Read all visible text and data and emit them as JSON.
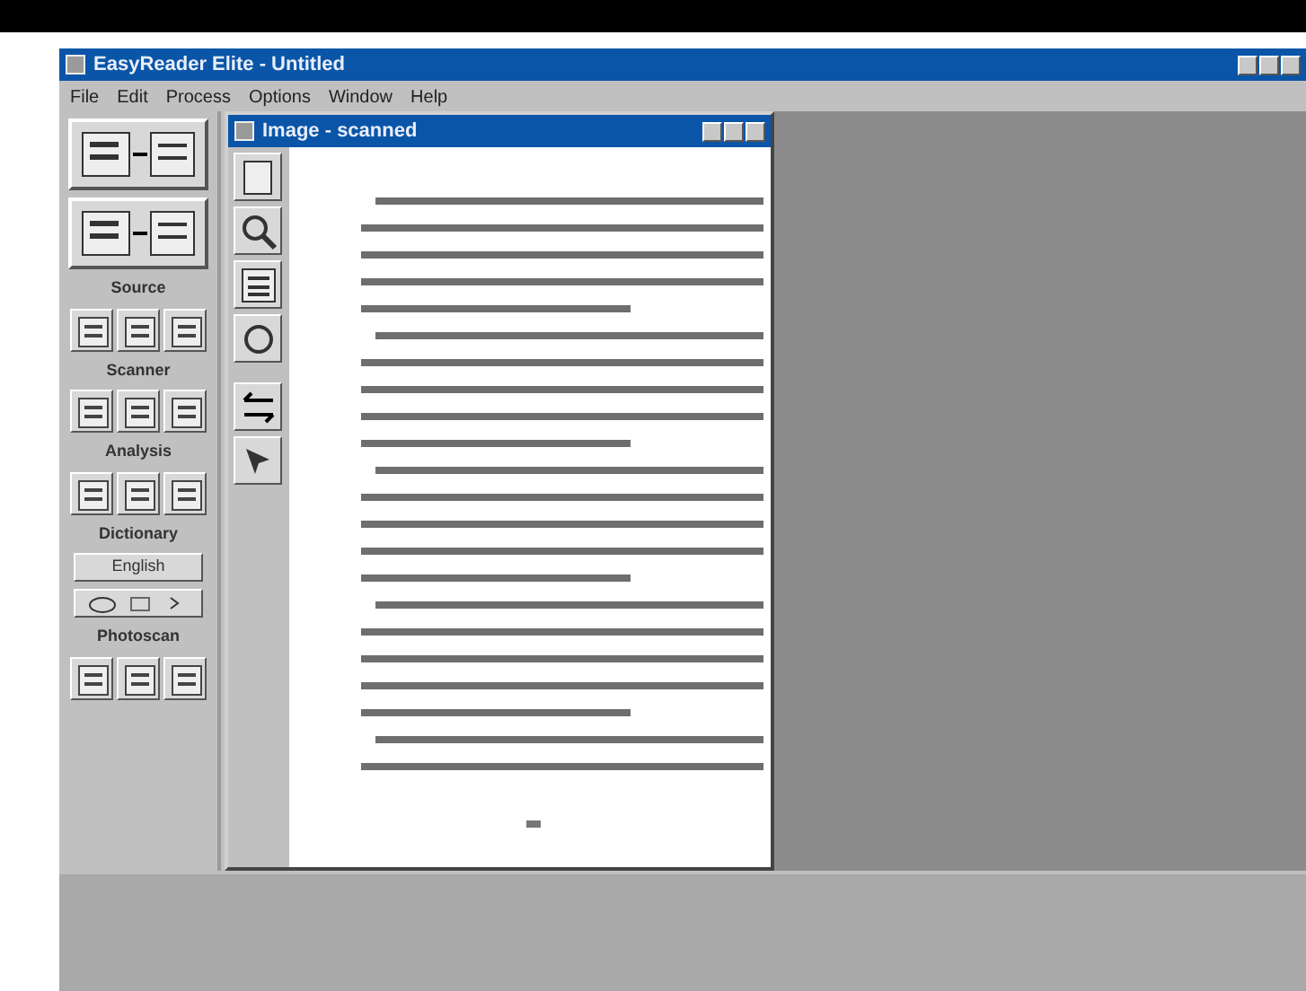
{
  "window": {
    "title": "EasyReader Elite - Untitled"
  },
  "menu": [
    {
      "label": "File"
    },
    {
      "label": "Edit"
    },
    {
      "label": "Process"
    },
    {
      "label": "Options"
    },
    {
      "label": "Window"
    },
    {
      "label": "Help"
    }
  ],
  "sidebar": [
    {
      "kind": "big-button"
    },
    {
      "kind": "big-button"
    },
    {
      "kind": "heading",
      "text": "Source"
    },
    {
      "kind": "icon-row"
    },
    {
      "kind": "heading",
      "text": "Scanner"
    },
    {
      "kind": "icon-row"
    },
    {
      "kind": "heading",
      "text": "Analysis"
    },
    {
      "kind": "icon-row"
    },
    {
      "kind": "heading",
      "text": "Dictionary"
    },
    {
      "kind": "text-button",
      "text": "English"
    },
    {
      "kind": "icon-bar"
    },
    {
      "kind": "heading",
      "text": "Photoscan"
    },
    {
      "kind": "icon-row"
    }
  ],
  "document_window": {
    "title": "Image - scanned"
  }
}
